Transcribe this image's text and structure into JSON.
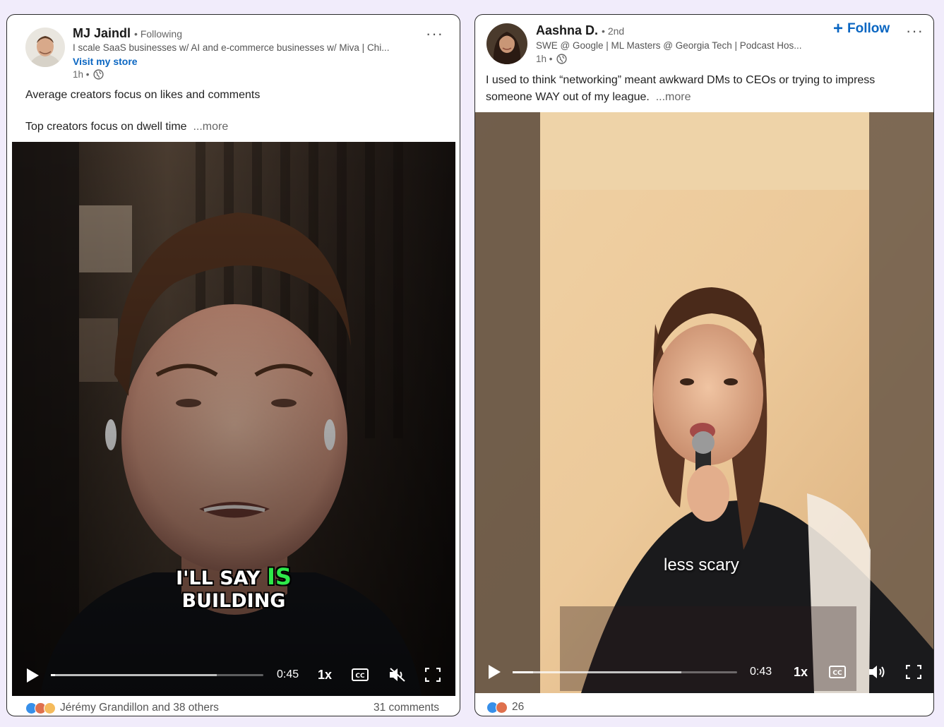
{
  "posts": [
    {
      "author": "MJ Jaindl",
      "degree": "• Following",
      "headline": "I scale SaaS businesses w/ AI and e-commerce businesses w/ Miva | Chi...",
      "store_link": "Visit my store",
      "time": "1h •",
      "text_line1": "Average creators focus on likes and comments",
      "text_line2": "Top creators focus on dwell time",
      "more": "...more",
      "caption_line1_a": "I'LL SAY",
      "caption_line1_b": "IS",
      "caption_line2": "BUILDING",
      "video_time": "0:45",
      "speed": "1x",
      "progress": 0.02,
      "buffered": 0.78,
      "reactions": "Jérémy Grandillon and 38 others",
      "comments": "31 comments",
      "muted": true
    },
    {
      "author": "Aashna D.",
      "degree": "• 2nd",
      "headline": "SWE @ Google | ML Masters @ Georgia Tech | Podcast Hos...",
      "time": "1h •",
      "follow": "Follow",
      "text_line1": "I used to think “networking” meant awkward DMs to CEOs or trying to impress",
      "text_line2": "someone WAY out of my league.",
      "more": "...more",
      "caption": "less scary",
      "video_time": "0:43",
      "speed": "1x",
      "progress": 0.09,
      "buffered": 0.75,
      "reactions": "26",
      "muted": false
    }
  ],
  "colors": {
    "link": "#0a66c2",
    "caption_highlight": "#2ee84a",
    "background": "#f1ecfb"
  }
}
